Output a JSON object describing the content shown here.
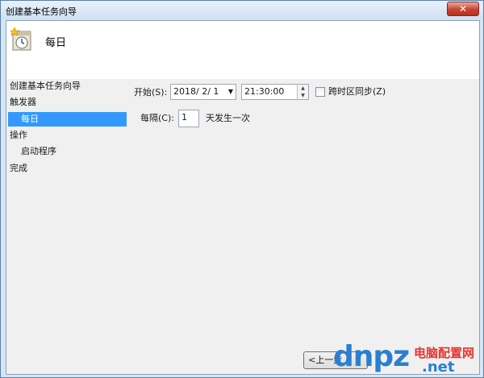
{
  "window": {
    "title": "创建基本任务向导",
    "close_label": "✕"
  },
  "header": {
    "title": "每日"
  },
  "sidebar": {
    "items": [
      {
        "label": "创建基本任务向导"
      },
      {
        "label": "触发器"
      },
      {
        "label": "每日",
        "selected": true
      },
      {
        "label": "操作"
      },
      {
        "label": "启动程序"
      },
      {
        "label": "完成"
      }
    ]
  },
  "main": {
    "start_label": "开始(S):",
    "date_value": "2018/  2/  1",
    "time_value": "21:30:00",
    "timezone_sync_label": "跨时区同步(Z)",
    "timezone_sync_checked": false,
    "recur_label": "每隔(C):",
    "recur_value": "1",
    "recur_suffix": "天发生一次"
  },
  "footer": {
    "back_label": "<上一步"
  },
  "watermark": {
    "domain": "dnpz",
    "cn": "电脑配置网",
    "net": ".net"
  },
  "colors": {
    "selection": "#3399ff",
    "accent": "#2a7fd0",
    "watermark_red": "#e9322c"
  }
}
